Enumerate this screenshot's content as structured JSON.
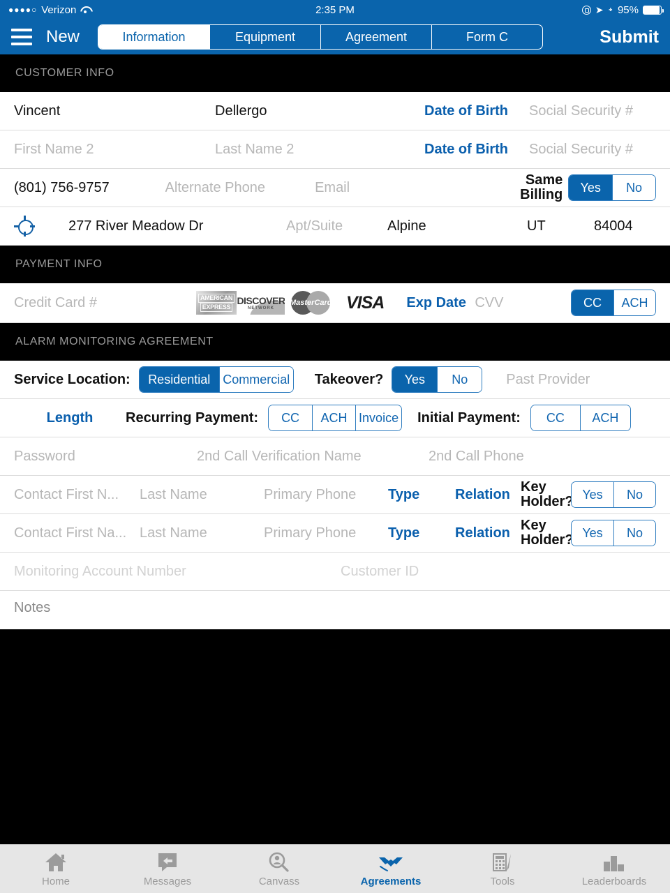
{
  "statusbar": {
    "signal_dots": "●●●●○",
    "carrier": "Verizon",
    "wifi_icon": "wifi-icon",
    "time": "2:35 PM",
    "rotation_lock_icon": "rotation-lock-icon",
    "location_icon": "location-arrow-icon",
    "bluetooth_icon": "bluetooth-icon",
    "battery_percent": "95%"
  },
  "navbar": {
    "menu_icon": "hamburger-menu-icon",
    "title": "New",
    "tabs": [
      {
        "label": "Information",
        "active": true
      },
      {
        "label": "Equipment",
        "active": false
      },
      {
        "label": "Agreement",
        "active": false
      },
      {
        "label": "Form C",
        "active": false
      }
    ],
    "submit_label": "Submit"
  },
  "sections": {
    "customer_info": {
      "header": "CUSTOMER INFO",
      "row1": {
        "first_name": "Vincent",
        "last_name": "Dellergo",
        "date_of_birth": "Date of Birth",
        "ssn": "Social Security #"
      },
      "row2": {
        "first_name_2": "First Name 2",
        "last_name_2": "Last Name 2",
        "date_of_birth": "Date of Birth",
        "ssn": "Social Security #"
      },
      "row3": {
        "phone": "(801) 756-9757",
        "alternate_phone": "Alternate Phone",
        "email": "Email",
        "same_billing_label": "Same Billing",
        "same_billing_options": [
          "Yes",
          "No"
        ],
        "same_billing_selected": "Yes"
      },
      "row4": {
        "gps_icon": "gps-target-icon",
        "street": "277 River Meadow Dr",
        "apt_suite": "Apt/Suite",
        "city": "Alpine",
        "state": "UT",
        "zip": "84004"
      }
    },
    "payment_info": {
      "header": "PAYMENT INFO",
      "credit_card_number": "Credit Card #",
      "card_logos": [
        "amex-logo",
        "discover-logo",
        "mastercard-logo",
        "visa-logo"
      ],
      "amex_line1": "AMERICAN",
      "amex_line2": "EXPRESS",
      "discover_line1": "DISCOVER",
      "discover_line2": "NETWORK",
      "mastercard_text": "MasterCard",
      "visa_text": "VISA",
      "exp_date": "Exp Date",
      "cvv": "CVV",
      "method_options": [
        "CC",
        "ACH"
      ],
      "method_selected": "CC"
    },
    "alarm_agreement": {
      "header": "ALARM MONITORING AGREEMENT",
      "service_location_label": "Service Location:",
      "service_location_options": [
        "Residential",
        "Commercial"
      ],
      "service_location_selected": "Residential",
      "takeover_label": "Takeover?",
      "takeover_options": [
        "Yes",
        "No"
      ],
      "takeover_selected": "Yes",
      "past_provider": "Past Provider",
      "length_label": "Length",
      "recurring_payment_label": "Recurring Payment:",
      "recurring_payment_options": [
        "CC",
        "ACH",
        "Invoice"
      ],
      "recurring_payment_selected": "",
      "initial_payment_label": "Initial Payment:",
      "initial_payment_options": [
        "CC",
        "ACH"
      ],
      "initial_payment_selected": "",
      "password": "Password",
      "second_call_verification_name": "2nd Call Verification Name",
      "second_call_phone": "2nd Call Phone",
      "contacts": [
        {
          "first_name": "Contact First N...",
          "last_name": "Last Name",
          "primary_phone": "Primary Phone",
          "type": "Type",
          "relation": "Relation",
          "key_holder_label": "Key Holder?",
          "key_holder_options": [
            "Yes",
            "No"
          ],
          "key_holder_selected": ""
        },
        {
          "first_name": "Contact First Na...",
          "last_name": "Last Name",
          "primary_phone": "Primary Phone",
          "type": "Type",
          "relation": "Relation",
          "key_holder_label": "Key Holder?",
          "key_holder_options": [
            "Yes",
            "No"
          ],
          "key_holder_selected": ""
        }
      ],
      "monitoring_account_number": "Monitoring Account Number",
      "customer_id": "Customer ID",
      "notes": "Notes"
    }
  },
  "tabbar": {
    "items": [
      {
        "label": "Home",
        "icon": "home-icon",
        "active": false
      },
      {
        "label": "Messages",
        "icon": "messages-icon",
        "active": false
      },
      {
        "label": "Canvass",
        "icon": "canvass-icon",
        "active": false
      },
      {
        "label": "Agreements",
        "icon": "handshake-icon",
        "active": true
      },
      {
        "label": "Tools",
        "icon": "tools-icon",
        "active": false
      },
      {
        "label": "Leaderboards",
        "icon": "leaderboards-icon",
        "active": false
      }
    ]
  },
  "colors": {
    "brand_blue": "#0a64ac",
    "link_blue": "#0a5fad",
    "section_bg": "#000000",
    "section_text": "#9a9a9a",
    "placeholder": "#b7b7b7",
    "tabbar_bg": "#e6e6e6"
  }
}
